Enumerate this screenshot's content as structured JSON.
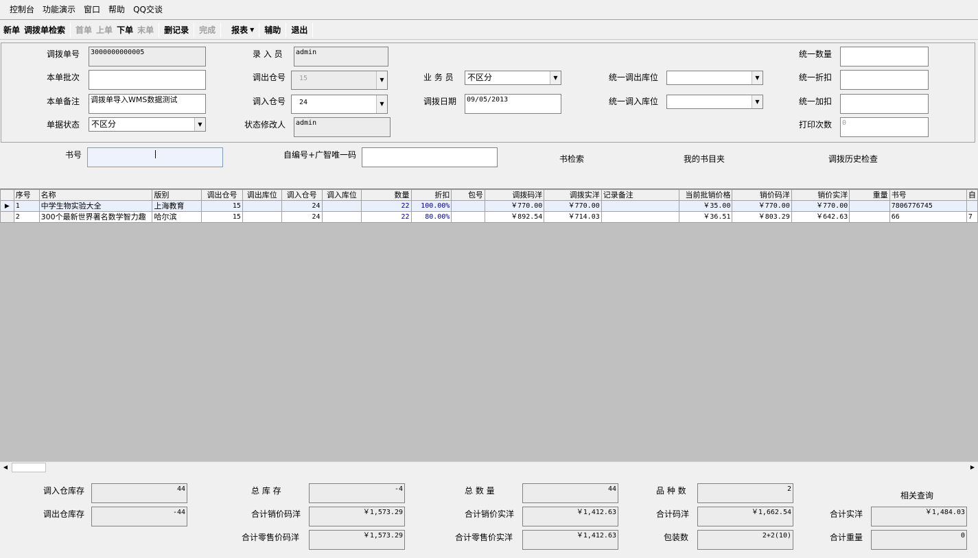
{
  "menu": [
    "控制台",
    "功能演示",
    "窗口",
    "帮助",
    "QQ交谈"
  ],
  "toolbar": {
    "new": "新单",
    "search": "调拨单检索",
    "first": "首单",
    "prev": "上单",
    "next": "下单",
    "last": "末单",
    "delete": "删记录",
    "done": "完成",
    "report": "报表",
    "assist": "辅助",
    "exit": "退出"
  },
  "form": {
    "order_no_label": "调拨单号",
    "order_no": "3000000000005",
    "batch_label": "本单批次",
    "batch": "",
    "remark_label": "本单备注",
    "remark": "调拨单导入WMS数据测试",
    "status_label": "单据状态",
    "status": "不区分",
    "entry_label": "录 入 员",
    "entry": "admin",
    "out_wh_label": "调出仓号",
    "out_wh": "15",
    "in_wh_label": "调入仓号",
    "in_wh": "24",
    "status_editor_label": "状态修改人",
    "status_editor": "admin",
    "salesman_label": "业 务 员",
    "salesman": "不区分",
    "date_label": "调拨日期",
    "date": "09/05/2013",
    "u_out_loc_label": "统一调出库位",
    "u_out_loc": "",
    "u_in_loc_label": "统一调入库位",
    "u_in_loc": "",
    "u_qty_label": "统一数量",
    "u_qty": "",
    "u_discount_label": "统一折扣",
    "u_discount": "",
    "u_markup_label": "统一加扣",
    "u_markup": "",
    "print_count_label": "打印次数",
    "print_count": "0"
  },
  "search": {
    "isbn_label": "书号",
    "isbn": "",
    "code_label": "自编号+广智唯一码",
    "code": "",
    "book_search": "书检索",
    "my_folder": "我的书目夹",
    "history": "调拨历史检查"
  },
  "grid": {
    "columns": [
      "序号",
      "名称",
      "版别",
      "调出仓号",
      "调出库位",
      "调入仓号",
      "调入库位",
      "数量",
      "折扣",
      "包号",
      "调拨码洋",
      "调拨实洋",
      "记录备注",
      "当前批销价格",
      "销价码洋",
      "销价实洋",
      "重量",
      "书号",
      "自"
    ],
    "rows": [
      [
        "1",
        "中学生物实验大全",
        "上海教育",
        "15",
        "",
        "24",
        "",
        "22",
        "100.00%",
        "",
        "￥770.00",
        "￥770.00",
        "",
        "￥35.00",
        "￥770.00",
        "￥770.00",
        "",
        "7806776745",
        ""
      ],
      [
        "2",
        "300个最新世界著名数学智力趣",
        "哈尔滨",
        "15",
        "",
        "24",
        "",
        "22",
        "80.00%",
        "",
        "￥892.54",
        "￥714.03",
        "",
        "￥36.51",
        "￥803.29",
        "￥642.63",
        "",
        "66",
        "7"
      ]
    ]
  },
  "summary": {
    "in_stock_label": "调入仓库存",
    "in_stock": "44",
    "out_stock_label": "调出仓库存",
    "out_stock": "-44",
    "total_stock_label": "总 库 存",
    "total_stock": "-4",
    "sum_sale_list_label": "合计销价码洋",
    "sum_sale_list": "￥1,573.29",
    "sum_retail_list_label": "合计零售价码洋",
    "sum_retail_list": "￥1,573.29",
    "total_qty_label": "总 数 量",
    "total_qty": "44",
    "sum_sale_net_label": "合计销价实洋",
    "sum_sale_net": "￥1,412.63",
    "sum_retail_net_label": "合计零售价实洋",
    "sum_retail_net": "￥1,412.63",
    "kinds_label": "品 种 数",
    "kinds": "2",
    "sum_list_label": "合计码洋",
    "sum_list": "￥1,662.54",
    "packs_label": "包装数",
    "packs": "2+2(10)",
    "related_query": "相关查询",
    "sum_net_label": "合计实洋",
    "sum_net": "￥1,484.03",
    "sum_weight_label": "合计重量",
    "sum_weight": "0"
  }
}
